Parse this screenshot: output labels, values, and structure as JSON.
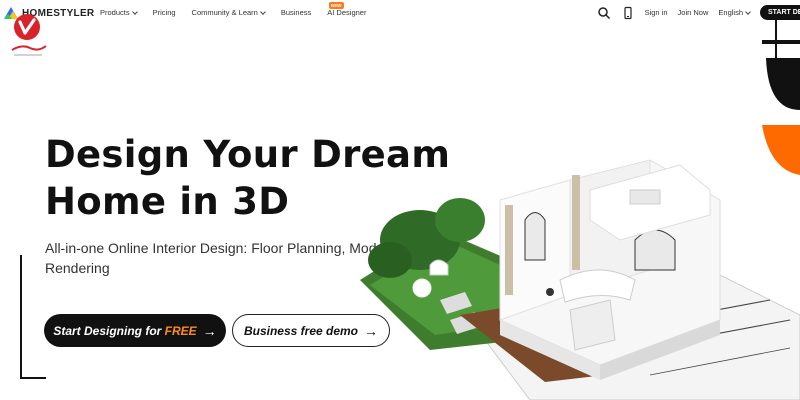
{
  "brand": {
    "logo_text": "HOMESTYLER"
  },
  "nav": {
    "items": [
      {
        "label": "Products",
        "dropdown": true
      },
      {
        "label": "Pricing",
        "dropdown": false
      },
      {
        "label": "Community & Learn",
        "dropdown": true
      },
      {
        "label": "Business",
        "dropdown": false
      },
      {
        "label": "AI Designer",
        "dropdown": false
      }
    ],
    "ai_badge": "NEW"
  },
  "right_nav": {
    "sign_in": "Sign in",
    "join_now": "Join Now",
    "language": "English",
    "start_button": "START DES"
  },
  "hero": {
    "headline_line1": "Design Your Dream",
    "headline_line2": "Home in 3D",
    "subline": "All-in-one Online Interior Design: Floor Planning, Modeling, Rendering",
    "cta_primary_prefix": "Start Designing for ",
    "cta_primary_free": "FREE",
    "cta_secondary": "Business free demo"
  },
  "colors": {
    "accent_orange": "#ff7a1a",
    "dark": "#111111",
    "watermark_red": "#d8232a"
  },
  "icons": [
    "search-icon",
    "mobile-icon",
    "chevron-down-icon",
    "arrow-right-icon"
  ]
}
